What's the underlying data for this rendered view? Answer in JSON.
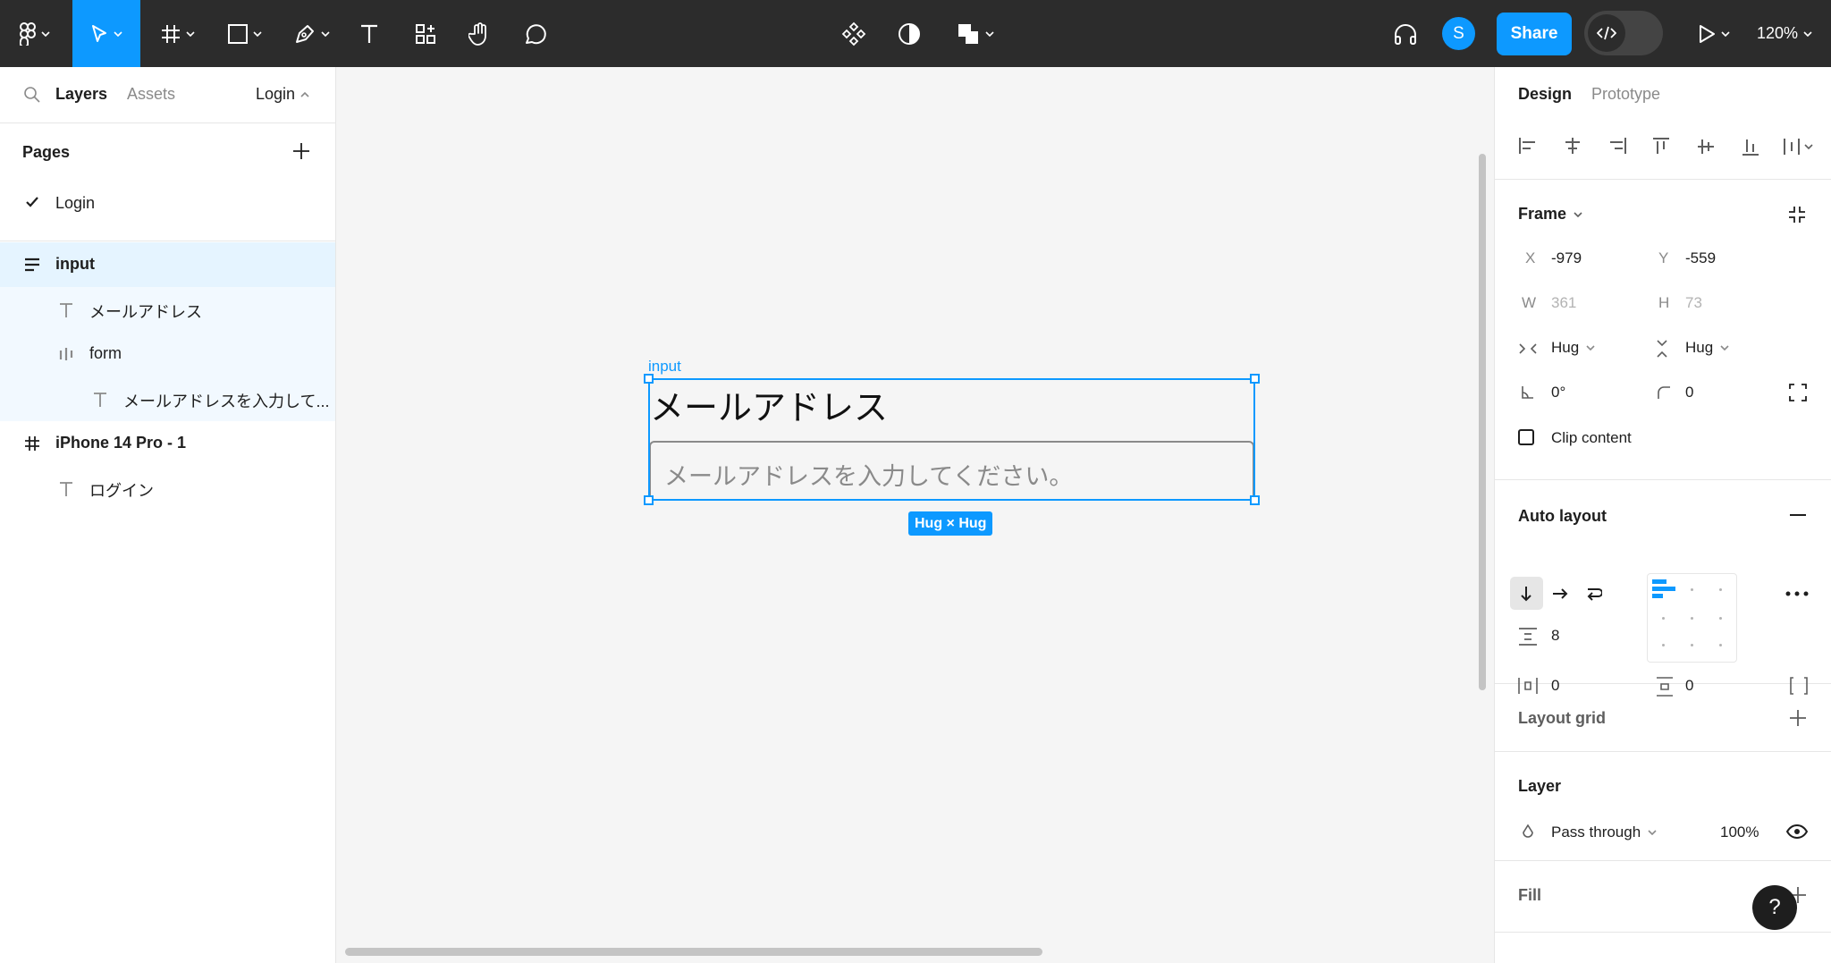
{
  "toolbar": {
    "share_label": "Share",
    "avatar_initial": "S",
    "zoom_label": "120%"
  },
  "left_panel": {
    "tabs": [
      "Layers",
      "Assets"
    ],
    "page_switch": "Login",
    "pages_title": "Pages",
    "current_page": "Login",
    "layers": [
      {
        "label": "input"
      },
      {
        "label": "メールアドレス"
      },
      {
        "label": "form"
      },
      {
        "label": "メールアドレスを入力して..."
      },
      {
        "label": "iPhone 14 Pro - 1"
      },
      {
        "label": "ログイン"
      }
    ]
  },
  "canvas": {
    "frame_label": "input",
    "title_text": "メールアドレス",
    "input_placeholder": "メールアドレスを入力してください。",
    "size_badge": "Hug × Hug"
  },
  "right_panel": {
    "tabs": [
      "Design",
      "Prototype"
    ],
    "frame": {
      "title": "Frame",
      "x_label": "X",
      "x": "-979",
      "y_label": "Y",
      "y": "-559",
      "w_label": "W",
      "w": "361",
      "h_label": "H",
      "h": "73",
      "width_mode": "Hug",
      "height_mode": "Hug",
      "rotation": "0°",
      "radius": "0",
      "clip_label": "Clip content"
    },
    "auto_layout": {
      "title": "Auto layout",
      "gap": "8",
      "padding_h": "0",
      "padding_v": "0"
    },
    "layout_grid_title": "Layout grid",
    "layer": {
      "title": "Layer",
      "blend": "Pass through",
      "opacity": "100%"
    },
    "fill_title": "Fill",
    "help_label": "?"
  }
}
